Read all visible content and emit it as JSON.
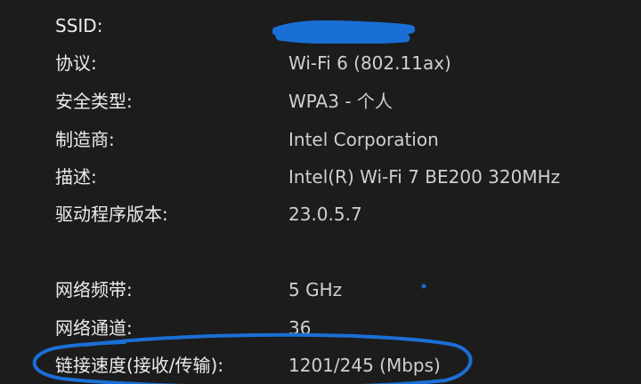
{
  "colors": {
    "background": "#1c1c1c",
    "label_text": "#ececec",
    "value_text": "#cfcfcf",
    "annotation": "#1a6fd6"
  },
  "properties": [
    {
      "label": "SSID:",
      "value": ""
    },
    {
      "label": "协议:",
      "value": "Wi-Fi 6 (802.11ax)"
    },
    {
      "label": "安全类型:",
      "value": "WPA3 - 个人"
    },
    {
      "label": "制造商:",
      "value": "Intel Corporation"
    },
    {
      "label": "描述:",
      "value": "Intel(R) Wi-Fi 7 BE200 320MHz"
    },
    {
      "label": "驱动程序版本:",
      "value": "23.0.5.7"
    },
    {
      "label": "网络频带:",
      "value": "5 GHz"
    },
    {
      "label": "网络通道:",
      "value": "36"
    },
    {
      "label": "链接速度(接收/传输):",
      "value": "1201/245 (Mbps)"
    }
  ]
}
